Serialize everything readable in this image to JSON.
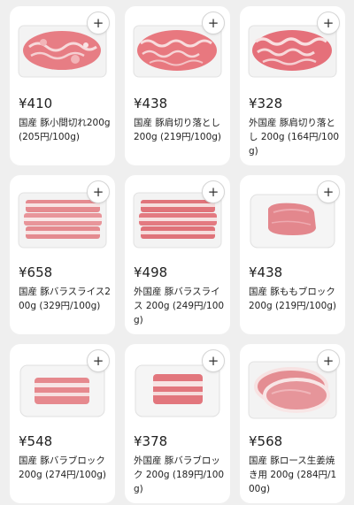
{
  "colors": {
    "background": "#efefef",
    "card": "#ffffff",
    "meat": "#e8878c",
    "fat": "#f6e3e1"
  },
  "add_icon": "plus-icon",
  "products": [
    {
      "id": "komagire",
      "image": "pork-scraps-tray",
      "price": "¥410",
      "description": "国産 豚小間切れ200g (205円/100g)"
    },
    {
      "id": "kata-kiriotoshi",
      "image": "pork-shoulder-cuts-tray",
      "price": "¥438",
      "description": "国産 豚肩切り落とし200g (219円/100g)"
    },
    {
      "id": "gaikoku-kata-kiriotoshi",
      "image": "imported-pork-shoulder-cuts-tray",
      "price": "¥328",
      "description": "外国産 豚肩切り落とし 200g (164円/100g)"
    },
    {
      "id": "bara-slice",
      "image": "pork-belly-slices-tray",
      "price": "¥658",
      "description": "国産 豚バラスライス200g (329円/100g)"
    },
    {
      "id": "gaikoku-bara-slice",
      "image": "imported-pork-belly-slices-tray",
      "price": "¥498",
      "description": "外国産 豚バラスライス 200g (249円/100g)"
    },
    {
      "id": "momo-block",
      "image": "pork-thigh-block-tray",
      "price": "¥438",
      "description": "国産 豚ももブロック200g (219円/100g)"
    },
    {
      "id": "bara-block",
      "image": "pork-belly-block-tray",
      "price": "¥548",
      "description": "国産 豚バラブロック200g (274円/100g)"
    },
    {
      "id": "gaikoku-bara-block",
      "image": "imported-pork-belly-block-tray",
      "price": "¥378",
      "description": "外国産 豚バラブロック 200g (189円/100g)"
    },
    {
      "id": "loin-shogayaki",
      "image": "pork-loin-ginger-tray",
      "price": "¥568",
      "description": "国産 豚ロース生姜焼き用 200g (284円/100g)"
    }
  ]
}
